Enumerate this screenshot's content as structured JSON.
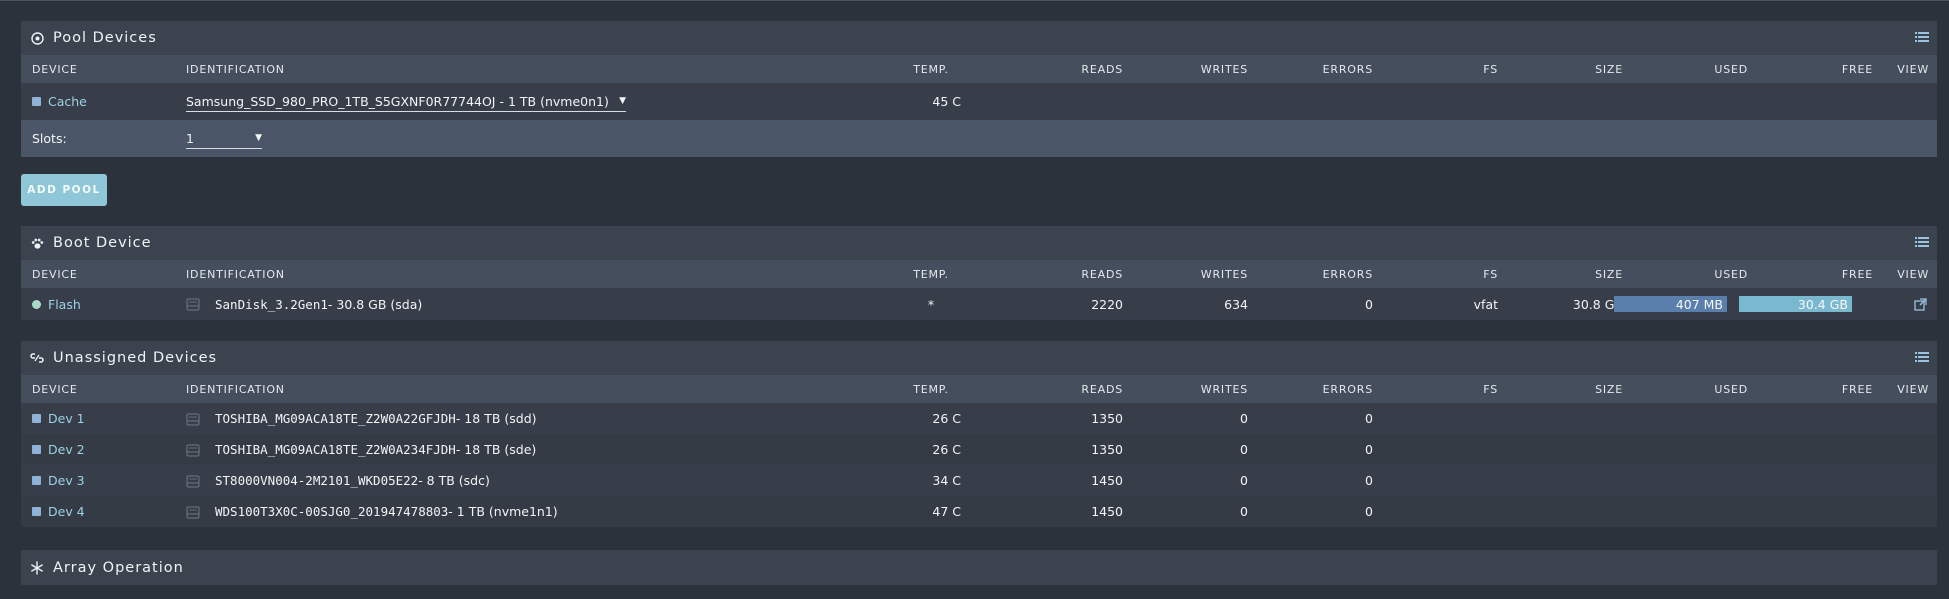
{
  "columns": {
    "device": "DEVICE",
    "identification": "IDENTIFICATION",
    "temp": "TEMP.",
    "reads": "READS",
    "writes": "WRITES",
    "errors": "ERRORS",
    "fs": "FS",
    "size": "SIZE",
    "used": "USED",
    "free": "FREE",
    "view": "VIEW"
  },
  "pool": {
    "title": "Pool Devices",
    "device": "Cache",
    "identification": "Samsung_SSD_980_PRO_1TB_S5GXNF0R77744OJ - 1 TB (nvme0n1)",
    "temp": "45 C",
    "slots_label": "Slots:",
    "slots_value": "1"
  },
  "add_pool_label": "ADD POOL",
  "boot": {
    "title": "Boot Device",
    "device": "Flash",
    "id_name": "SanDisk_3.2Gen1",
    "id_rest": " - 30.8 GB (sda)",
    "temp": "*",
    "reads": "2220",
    "writes": "634",
    "errors": "0",
    "fs": "vfat",
    "size": "30.8 GB",
    "used": "407 MB",
    "free": "30.4 GB",
    "used_color": "#5b7fac",
    "free_color": "#7ab8cf"
  },
  "unassigned": {
    "title": "Unassigned Devices",
    "rows": [
      {
        "device": "Dev 1",
        "id_name": "TOSHIBA_MG09ACA18TE_Z2W0A22GFJDH",
        "id_rest": " - 18 TB (sdd)",
        "temp": "26 C",
        "reads": "1350",
        "writes": "0",
        "errors": "0"
      },
      {
        "device": "Dev 2",
        "id_name": "TOSHIBA_MG09ACA18TE_Z2W0A234FJDH",
        "id_rest": " - 18 TB (sde)",
        "temp": "26 C",
        "reads": "1350",
        "writes": "0",
        "errors": "0"
      },
      {
        "device": "Dev 3",
        "id_name": "ST8000VN004-2M2101_WKD05E22",
        "id_rest": " - 8 TB (sdc)",
        "temp": "34 C",
        "reads": "1450",
        "writes": "0",
        "errors": "0"
      },
      {
        "device": "Dev 4",
        "id_name": "WDS100T3X0C-00SJG0_201947478803",
        "id_rest": " - 1 TB (nvme1n1)",
        "temp": "47 C",
        "reads": "1450",
        "writes": "0",
        "errors": "0"
      }
    ]
  },
  "array": {
    "title": "Array Operation"
  },
  "icons": {
    "pool": "disc-icon",
    "boot": "paw-icon",
    "unassigned": "unlink-icon",
    "array": "snowflake-icon",
    "list": "list-icon",
    "disk": "hard-drive-icon",
    "external": "external-link-icon"
  }
}
